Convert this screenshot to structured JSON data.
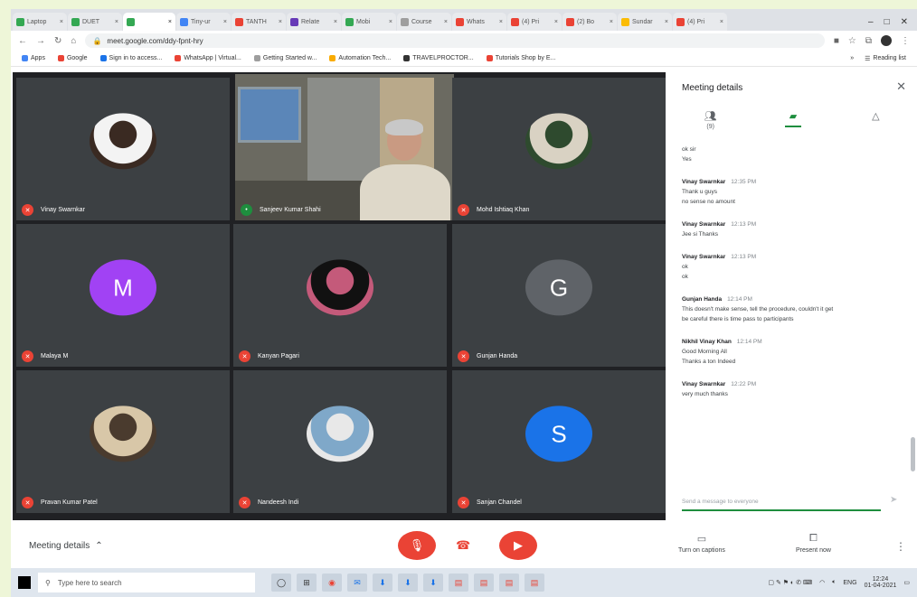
{
  "browser": {
    "tabs": [
      {
        "label": "Laptop",
        "color": "#34a853"
      },
      {
        "label": "DUET",
        "color": "#34a853"
      },
      {
        "label": "",
        "color": "#34a853",
        "active": true
      },
      {
        "label": "Tiny-ur",
        "color": "#4285f4"
      },
      {
        "label": "TANTH",
        "color": "#ea4335"
      },
      {
        "label": "Relate",
        "color": "#673ab7"
      },
      {
        "label": "Mobi",
        "color": "#34a853"
      },
      {
        "label": "Course",
        "color": "#9e9e9e"
      },
      {
        "label": "Whats",
        "color": "#ea4335"
      },
      {
        "label": "(4) Pri",
        "color": "#ea4335"
      },
      {
        "label": "(2) Bo",
        "color": "#ea4335"
      },
      {
        "label": "Sundar",
        "color": "#fbbc05"
      },
      {
        "label": "(4) Pri",
        "color": "#ea4335"
      }
    ],
    "url": "meet.google.com/ddy-fpnt-hry",
    "bookmarks": [
      {
        "label": "Apps",
        "color": "#4285f4"
      },
      {
        "label": "Google",
        "color": "#ea4335"
      },
      {
        "label": "Sign in to access...",
        "color": "#1a73e8"
      },
      {
        "label": "WhatsApp | Virtual...",
        "color": "#ea4335"
      },
      {
        "label": "Getting Started w...",
        "color": "#9e9e9e"
      },
      {
        "label": "Automation Tech...",
        "color": "#f9ab00"
      },
      {
        "label": "TRAVELPROCTOR...",
        "color": "#333333"
      },
      {
        "label": "Tutorials Shop by E...",
        "color": "#ea4335"
      }
    ],
    "reading_list": "Reading list"
  },
  "participants": [
    {
      "name": "Vinay Swarnkar",
      "avatar": "photo",
      "muted": true
    },
    {
      "name": "Sanjeev Kumar Shahi",
      "avatar": "video",
      "muted": false
    },
    {
      "name": "Mohd Ishtiaq Khan",
      "avatar": "photo",
      "muted": true
    },
    {
      "name": "Malaya M",
      "avatar": "M",
      "avatar_color": "#a142f4",
      "muted": true
    },
    {
      "name": "Kanyan Pagari",
      "avatar": "photo",
      "muted": true
    },
    {
      "name": "Gunjan Handa",
      "avatar": "G",
      "avatar_color": "#5f6368",
      "muted": true
    },
    {
      "name": "Pravan Kumar Patel",
      "avatar": "photo",
      "muted": true
    },
    {
      "name": "Nandeesh Indi",
      "avatar": "photo",
      "muted": true
    },
    {
      "name": "Sanjan Chandel",
      "avatar": "S",
      "avatar_color": "#1a73e8",
      "muted": true
    }
  ],
  "panel": {
    "title": "Meeting details",
    "tabs": [
      {
        "label": "(9)",
        "icon": "people-icon"
      },
      {
        "label": "",
        "icon": "chat-icon",
        "active": true
      },
      {
        "label": "",
        "icon": "activities-icon"
      }
    ],
    "messages": [
      {
        "sender": "",
        "time": "",
        "lines": [
          "ok sir",
          "Yes"
        ]
      },
      {
        "sender": "Vinay Swarnkar",
        "time": "12:35 PM",
        "lines": [
          "Thank u guys",
          "no sense no amount"
        ]
      },
      {
        "sender": "Vinay Swarnkar",
        "time": "12:13 PM",
        "lines": [
          "Jee si Thanks"
        ]
      },
      {
        "sender": "Vinay Swarnkar",
        "time": "12:13 PM",
        "lines": [
          "ok",
          "ok"
        ]
      },
      {
        "sender": "Gunjan Handa",
        "time": "12:14 PM",
        "lines": [
          "This doesn't make sense, tell the procedure, couldn't it get",
          "be careful there is time pass to participants"
        ]
      },
      {
        "sender": "Nikhil Vinay Khan",
        "time": "12:14 PM",
        "lines": [
          "Good Morning All",
          "Thanks a ton Indeed"
        ]
      },
      {
        "sender": "Vinay Swarnkar",
        "time": "12:22 PM",
        "lines": [
          "very much thanks"
        ]
      }
    ],
    "input_placeholder": "Send a message to everyone"
  },
  "controls": {
    "meeting_details": "Meeting details",
    "captions": "Turn on captions",
    "present": "Present now"
  },
  "taskbar": {
    "search_placeholder": "Type here to search",
    "time": "12:24",
    "date": "01-04-2021",
    "lang": "ENG"
  }
}
